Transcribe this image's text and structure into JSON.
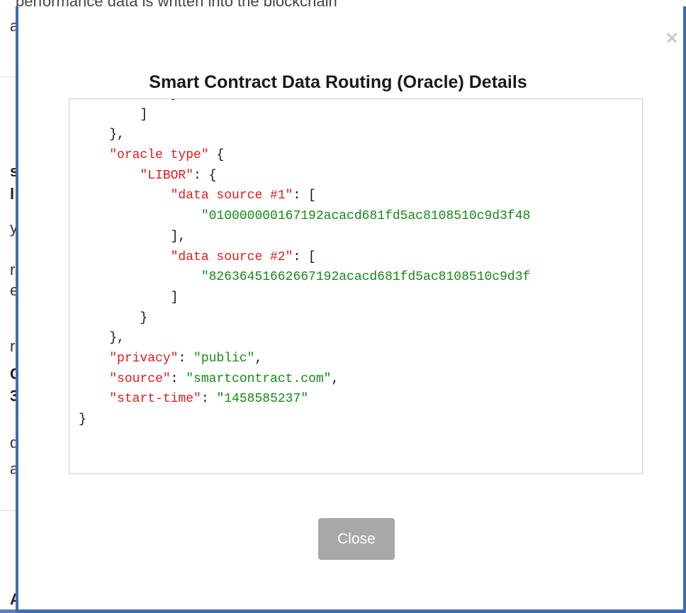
{
  "background": {
    "top_text": "performance data is written into the blockchain",
    "left_glyphs": [
      "a",
      "s",
      "l",
      "y",
      "r",
      "e",
      "r",
      "C",
      "3",
      "d",
      "a",
      "A"
    ]
  },
  "modal": {
    "title": "Smart Contract Data Routing (Oracle) Details",
    "close_icon": "×",
    "close_button_label": "Close",
    "code_lines": [
      [
        {
          "t": "p",
          "v": "            }"
        }
      ],
      [
        {
          "t": "p",
          "v": "        ]"
        }
      ],
      [
        {
          "t": "p",
          "v": "    },"
        }
      ],
      [
        {
          "t": "p",
          "v": "    "
        },
        {
          "t": "k",
          "v": "\"oracle type\""
        },
        {
          "t": "p",
          "v": " {"
        }
      ],
      [
        {
          "t": "p",
          "v": "        "
        },
        {
          "t": "k",
          "v": "\"LIBOR\""
        },
        {
          "t": "p",
          "v": ": {"
        }
      ],
      [
        {
          "t": "p",
          "v": "            "
        },
        {
          "t": "k",
          "v": "\"data source #1\""
        },
        {
          "t": "p",
          "v": ": ["
        }
      ],
      [
        {
          "t": "p",
          "v": "                "
        },
        {
          "t": "s",
          "v": "\"010000000167192acacd681fd5ac8108510c9d3f48"
        }
      ],
      [
        {
          "t": "p",
          "v": "            ],"
        }
      ],
      [
        {
          "t": "p",
          "v": "            "
        },
        {
          "t": "k",
          "v": "\"data source #2\""
        },
        {
          "t": "p",
          "v": ": ["
        }
      ],
      [
        {
          "t": "p",
          "v": "                "
        },
        {
          "t": "s",
          "v": "\"82636451662667192acacd681fd5ac8108510c9d3f"
        }
      ],
      [
        {
          "t": "p",
          "v": "            ]"
        }
      ],
      [
        {
          "t": "p",
          "v": "        }"
        }
      ],
      [
        {
          "t": "p",
          "v": "    },"
        }
      ],
      [
        {
          "t": "p",
          "v": "    "
        },
        {
          "t": "k",
          "v": "\"privacy\""
        },
        {
          "t": "p",
          "v": ": "
        },
        {
          "t": "s",
          "v": "\"public\""
        },
        {
          "t": "p",
          "v": ","
        }
      ],
      [
        {
          "t": "p",
          "v": "    "
        },
        {
          "t": "k",
          "v": "\"source\""
        },
        {
          "t": "p",
          "v": ": "
        },
        {
          "t": "s",
          "v": "\"smartcontract.com\""
        },
        {
          "t": "p",
          "v": ","
        }
      ],
      [
        {
          "t": "p",
          "v": "    "
        },
        {
          "t": "k",
          "v": "\"start-time\""
        },
        {
          "t": "p",
          "v": ": "
        },
        {
          "t": "s",
          "v": "\"1458585237\""
        }
      ],
      [
        {
          "t": "p",
          "v": "}"
        }
      ]
    ]
  },
  "colors": {
    "json_key": "#e01b1b",
    "json_string": "#148a14",
    "backdrop_edge": "#3f6db4",
    "close_button_bg": "#a8a8a8"
  }
}
